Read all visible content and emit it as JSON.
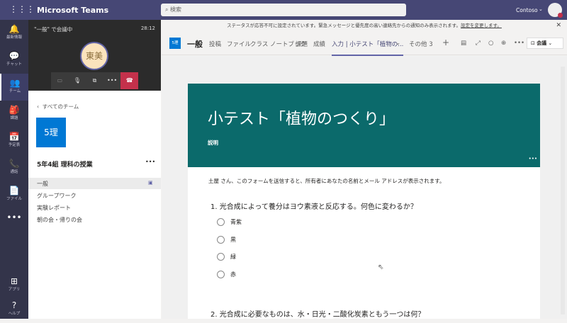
{
  "app": {
    "title": "Microsoft Teams",
    "search_placeholder": "検索",
    "org": "Contoso"
  },
  "rail": [
    {
      "label": "最新情報",
      "icon": "bell-icon",
      "glyph": "🔔"
    },
    {
      "label": "チャット",
      "icon": "chat-icon",
      "glyph": "💬"
    },
    {
      "label": "チーム",
      "icon": "teams-icon",
      "glyph": "👥"
    },
    {
      "label": "課題",
      "icon": "assignment-icon",
      "glyph": "🎒"
    },
    {
      "label": "予定表",
      "icon": "calendar-icon",
      "glyph": "📅"
    },
    {
      "label": "通話",
      "icon": "phone-icon",
      "glyph": "📞"
    },
    {
      "label": "ファイル",
      "icon": "file-icon",
      "glyph": "📄"
    }
  ],
  "rail_more": "•••",
  "rail_bottom": [
    {
      "label": "アプリ",
      "icon": "apps-icon",
      "glyph": "⊞"
    },
    {
      "label": "ヘルプ",
      "icon": "help-icon",
      "glyph": "?"
    }
  ],
  "meeting": {
    "title": "\"一般\" で会議中",
    "time": "28:12",
    "avatar": "東美"
  },
  "team": {
    "back": "すべてのチーム",
    "tile": "5理",
    "name": "5年4組 理科の授業",
    "more": "•••",
    "channels": [
      "一般",
      "グループワーク",
      "実験レポート",
      "朝の会・帰りの会"
    ]
  },
  "notice": {
    "text": "ステータスが応答不可に設定されています。緊急メッセージと優先度の高い連絡先からの通知のみ表示されます。",
    "link": "設定を変更します。"
  },
  "tabs": {
    "tile": "5理",
    "channel": "一般",
    "items": [
      "投稿",
      "ファイル",
      "クラス ノートブック",
      "課題",
      "成績",
      "入力 | 小テスト「植物の..."
    ],
    "more": "その他 3",
    "meet": "会議"
  },
  "form": {
    "title": "小テスト「植物のつくり」",
    "desc": "説明",
    "notice": "土屋 さん、このフォームを送信すると、所有者にあなたの名前とメール アドレスが表示されます。",
    "q1": "1. 光合成によって養分はヨウ素液と反応する。何色に変わるか？",
    "q1_options": [
      "青紫",
      "黒",
      "緑",
      "赤"
    ],
    "q2": "2. 光合成に必要なものは、水・日光・二酸化炭素ともう一つは何？",
    "header_color": "#0b6a6b"
  }
}
